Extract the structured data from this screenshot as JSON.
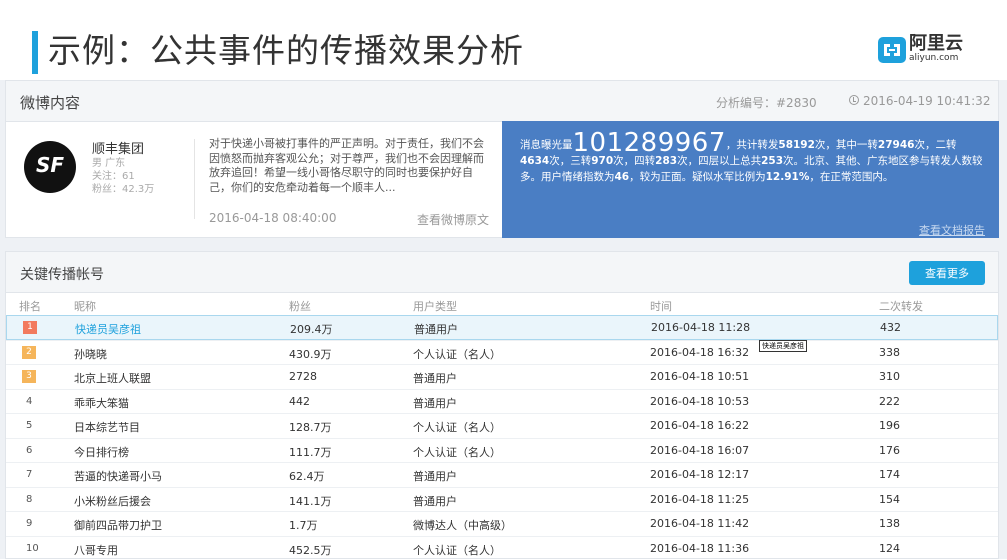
{
  "slide": {
    "title": "示例：公共事件的传播效果分析",
    "logo_cn": "阿里云",
    "logo_en": "aliyun.com"
  },
  "colors": {
    "accent": "#1ea1dc",
    "summary_bg": "#4a7ec4",
    "rank_1": "#f27a5e",
    "rank_2_3": "#f5b55b"
  },
  "weibo": {
    "header_title": "微博内容",
    "analysis_no": "分析编号：#2830",
    "timestamp": "2016-04-19 10:41:32",
    "user": {
      "name": "顺丰集团",
      "gender_location": "男 广东",
      "following": "关注：61",
      "followers": "粉丝：42.3万",
      "avatar_text": "SF"
    },
    "post_text": "对于快递小哥被打事件的严正声明。对于责任，我们不会因愤怒而抛弃客观公允；对于尊严，我们也不会因理解而放弃追回！希望一线小哥恪尽职守的同时也要保护好自己，你们的安危牵动着每一个顺丰人...",
    "post_date": "2016-04-18 08:40:00",
    "view_original": "查看微博原文",
    "summary": {
      "prefix": "消息曝光量",
      "exposure": "101289967",
      "part1": "，共计转发",
      "total_reposts": "58192",
      "part2": "次，其中一转",
      "first": "27946",
      "part3": "次，二转",
      "second": "4634",
      "part4": "次，三转",
      "third": "970",
      "part5": "次，四转",
      "fourth": "283",
      "part6": "次，四层以上总共",
      "above_four": "253",
      "part7": "次。北京、其他、广东地区参与转发人数较多。用户情绪指数为",
      "mood_index": "46",
      "part8": "，较为正面。疑似水军比例为",
      "bot_ratio": "12.91%",
      "part9": "，在正常范围内。",
      "report_link": "查看文档报告"
    }
  },
  "accounts": {
    "header_title": "关键传播帐号",
    "view_more": "查看更多",
    "columns": {
      "rank": "排名",
      "nickname": "昵称",
      "fans": "粉丝",
      "user_type": "用户类型",
      "time": "时间",
      "reposts": "二次转发"
    },
    "tooltip": "快递员吴彦祖",
    "rows": [
      {
        "rank": "1",
        "nickname": "快递员吴彦祖",
        "fans": "209.4万",
        "user_type": "普通用户",
        "time": "2016-04-18 11:28",
        "reposts": "432"
      },
      {
        "rank": "2",
        "nickname": "孙晓晓",
        "fans": "430.9万",
        "user_type": "个人认证（名人）",
        "time": "2016-04-18 16:32",
        "reposts": "338"
      },
      {
        "rank": "3",
        "nickname": "北京上班人联盟",
        "fans": "2728",
        "user_type": "普通用户",
        "time": "2016-04-18 10:51",
        "reposts": "310"
      },
      {
        "rank": "4",
        "nickname": "乖乖大笨猫",
        "fans": "442",
        "user_type": "普通用户",
        "time": "2016-04-18 10:53",
        "reposts": "222"
      },
      {
        "rank": "5",
        "nickname": "日本综艺节目",
        "fans": "128.7万",
        "user_type": "个人认证（名人）",
        "time": "2016-04-18 16:22",
        "reposts": "196"
      },
      {
        "rank": "6",
        "nickname": "今日排行榜",
        "fans": "111.7万",
        "user_type": "个人认证（名人）",
        "time": "2016-04-18 16:07",
        "reposts": "176"
      },
      {
        "rank": "7",
        "nickname": "苦逼的快递哥小马",
        "fans": "62.4万",
        "user_type": "普通用户",
        "time": "2016-04-18 12:17",
        "reposts": "174"
      },
      {
        "rank": "8",
        "nickname": "小米粉丝后援会",
        "fans": "141.1万",
        "user_type": "普通用户",
        "time": "2016-04-18 11:25",
        "reposts": "154"
      },
      {
        "rank": "9",
        "nickname": "御前四品带刀护卫",
        "fans": "1.7万",
        "user_type": "微博达人（中高级）",
        "time": "2016-04-18 11:42",
        "reposts": "138"
      },
      {
        "rank": "10",
        "nickname": "八哥专用",
        "fans": "452.5万",
        "user_type": "个人认证（名人）",
        "time": "2016-04-18 11:36",
        "reposts": "124"
      }
    ]
  }
}
